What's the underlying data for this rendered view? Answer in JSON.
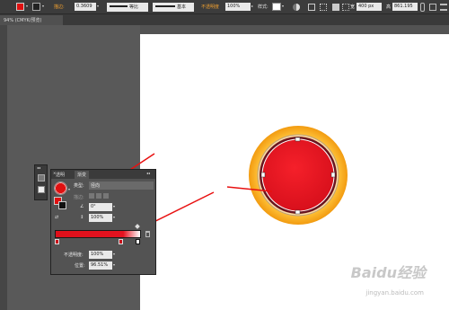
{
  "control_bar": {
    "fill_color": "#e01010",
    "stroke_label": "描边:",
    "stroke_value": "0.3609",
    "uniform_label": "等比",
    "brush_label": "基本",
    "opacity_label": "不透明度",
    "opacity_value": "100%",
    "style_label": "样式:",
    "w_value": "400 px",
    "h_value": "861.195",
    "w_label": "宽",
    "h_label": "高"
  },
  "document_tab": {
    "title": "94% (CMYK/预览)"
  },
  "gradient_panel": {
    "tab_close": "✕",
    "tab_options": "◂◂",
    "tab_transparency": "透明",
    "tab_gradient": "渐变",
    "type_label": "类型:",
    "type_value": "径向",
    "stroke_label": "描边:",
    "angle_value": "0°",
    "aspect_value": "100%",
    "opacity_label": "不透明度:",
    "opacity_value": "100%",
    "location_label": "位置:",
    "location_value": "96.51%"
  },
  "watermark": {
    "brand": "Baidu经验",
    "url": "jingyan.baidu.com"
  }
}
